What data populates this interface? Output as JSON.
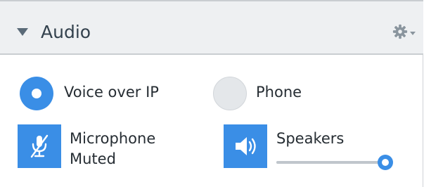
{
  "panel": {
    "title": "Audio"
  },
  "connection": {
    "options": [
      {
        "label": "Voice over IP",
        "selected": true
      },
      {
        "label": "Phone",
        "selected": false
      }
    ]
  },
  "microphone": {
    "label_line1": "Microphone",
    "label_line2": "Muted",
    "icon": "microphone-muted-icon"
  },
  "speakers": {
    "label": "Speakers",
    "icon": "speaker-icon",
    "volume": 1.0
  },
  "colors": {
    "accent": "#3a8ee6",
    "header_bg": "#eef0f2",
    "text": "#262d33"
  }
}
